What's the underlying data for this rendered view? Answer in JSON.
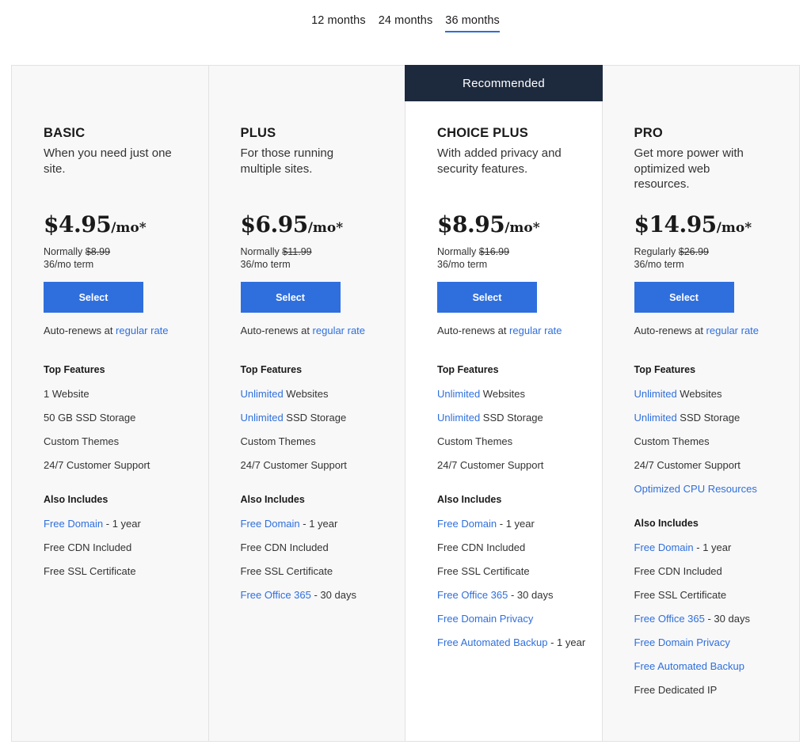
{
  "tabs": [
    {
      "label": "12 months",
      "active": false
    },
    {
      "label": "24 months",
      "active": false
    },
    {
      "label": "36 months",
      "active": true
    }
  ],
  "common": {
    "select_label": "Select",
    "renew_prefix": "Auto-renews at ",
    "renew_link": "regular rate",
    "top_features_heading": "Top Features",
    "also_includes_heading": "Also Includes",
    "price_suffix": "/mo*"
  },
  "plans": [
    {
      "name": "BASIC",
      "desc": "When you need just one site.",
      "price": "$4.95",
      "normal_label": "Normally ",
      "normal_price": "$8.99",
      "term": "36/mo term",
      "top": [
        {
          "link": "",
          "text": "1 Website"
        },
        {
          "link": "",
          "text": "50 GB SSD Storage"
        },
        {
          "link": "",
          "text": "Custom Themes"
        },
        {
          "link": "",
          "text": "24/7 Customer Support"
        }
      ],
      "also": [
        {
          "link": "Free Domain",
          "text": " - 1 year"
        },
        {
          "link": "",
          "text": "Free CDN Included"
        },
        {
          "link": "",
          "text": "Free SSL Certificate"
        }
      ]
    },
    {
      "name": "PLUS",
      "desc": "For those running multiple sites.",
      "price": "$6.95",
      "normal_label": "Normally ",
      "normal_price": "$11.99",
      "term": "36/mo term",
      "top": [
        {
          "link": "Unlimited",
          "text": " Websites"
        },
        {
          "link": "Unlimited",
          "text": " SSD Storage"
        },
        {
          "link": "",
          "text": "Custom Themes"
        },
        {
          "link": "",
          "text": "24/7 Customer Support"
        }
      ],
      "also": [
        {
          "link": "Free Domain",
          "text": " - 1 year"
        },
        {
          "link": "",
          "text": "Free CDN Included"
        },
        {
          "link": "",
          "text": "Free SSL Certificate"
        },
        {
          "link": "Free Office 365",
          "text": " - 30 days"
        }
      ]
    },
    {
      "name": "CHOICE PLUS",
      "desc": "With added privacy and security features.",
      "recommended": "Recommended",
      "price": "$8.95",
      "normal_label": "Normally ",
      "normal_price": "$16.99",
      "term": "36/mo term",
      "top": [
        {
          "link": "Unlimited",
          "text": " Websites"
        },
        {
          "link": "Unlimited",
          "text": " SSD Storage"
        },
        {
          "link": "",
          "text": "Custom Themes"
        },
        {
          "link": "",
          "text": "24/7 Customer Support"
        }
      ],
      "also": [
        {
          "link": "Free Domain",
          "text": " - 1 year"
        },
        {
          "link": "",
          "text": "Free CDN Included"
        },
        {
          "link": "",
          "text": "Free SSL Certificate"
        },
        {
          "link": "Free Office 365",
          "text": " - 30 days"
        },
        {
          "link": "Free Domain Privacy",
          "text": ""
        },
        {
          "link": "Free Automated Backup",
          "text": " - 1 year"
        }
      ]
    },
    {
      "name": "PRO",
      "desc": "Get more power with optimized web resources.",
      "price": "$14.95",
      "normal_label": "Regularly ",
      "normal_price": "$26.99",
      "term": "36/mo term",
      "top": [
        {
          "link": "Unlimited",
          "text": " Websites"
        },
        {
          "link": "Unlimited",
          "text": " SSD Storage"
        },
        {
          "link": "",
          "text": "Custom Themes"
        },
        {
          "link": "",
          "text": "24/7 Customer Support"
        },
        {
          "link": "Optimized CPU Resources",
          "text": ""
        }
      ],
      "also": [
        {
          "link": "Free Domain",
          "text": " - 1 year"
        },
        {
          "link": "",
          "text": "Free CDN Included"
        },
        {
          "link": "",
          "text": "Free SSL Certificate"
        },
        {
          "link": "Free Office 365",
          "text": " - 30 days"
        },
        {
          "link": "Free Domain Privacy",
          "text": ""
        },
        {
          "link": "Free Automated Backup",
          "text": ""
        },
        {
          "link": "",
          "text": "Free Dedicated IP"
        }
      ]
    }
  ],
  "colors": {
    "accent": "#2f6fdd",
    "banner": "#1d2a3e",
    "panel": "#f8f8f8"
  }
}
